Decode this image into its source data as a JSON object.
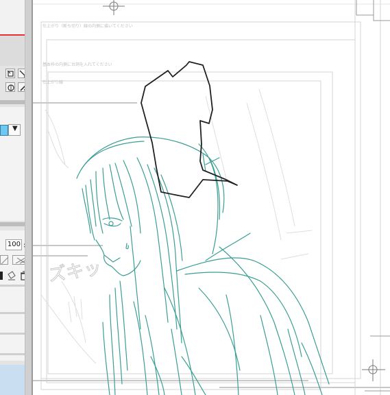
{
  "tool_property": {
    "opacity_value": "100"
  },
  "canvas": {
    "guide_text_top": "仕上がり（断ち切り）線の内側に描いてください",
    "guide_text_mid": "基本枠の内側に台詞を入れてください",
    "guide_text_small": "仕上がり線",
    "sfx_text": "ズキッ"
  },
  "colors": {
    "sketch_stroke": "#3a9e93",
    "guide_line": "#cfcfcf",
    "selection_stroke": "#202020",
    "panel_bg": "#e4e4e4",
    "red_frame": "#e33232",
    "swatch": "#6fc8f2"
  },
  "icons": [
    "transform-icon",
    "resize-icon",
    "color-wheel-icon",
    "eyedropper-icon",
    "dropdown-arrow-icon",
    "spin-up-icon",
    "spin-down-icon",
    "gradient-icon",
    "mask-icon",
    "bucket-icon",
    "eraser-icon",
    "trash-icon",
    "registration-mark-icon"
  ]
}
